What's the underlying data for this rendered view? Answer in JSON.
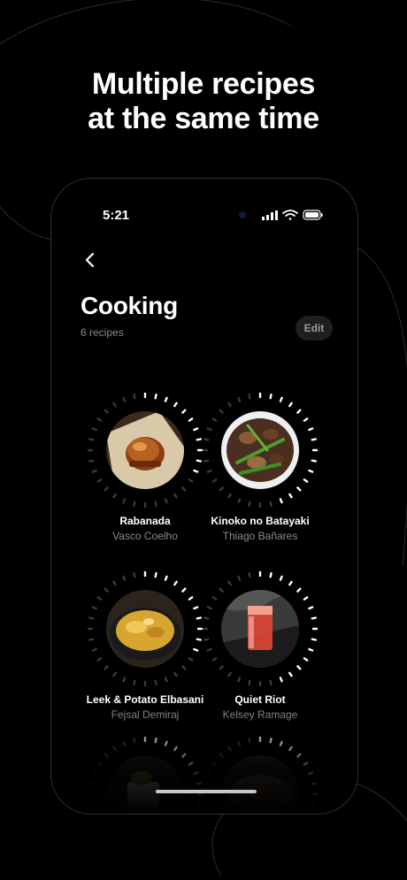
{
  "headline": {
    "line1": "Multiple recipes",
    "line2": "at the same time"
  },
  "status_bar": {
    "time": "5:21"
  },
  "nav": {
    "back_icon": "chevron-left-icon"
  },
  "page": {
    "title": "Cooking",
    "subtitle": "6 recipes",
    "edit_label": "Edit"
  },
  "recipes": [
    {
      "name": "Rabanada",
      "author": "Vasco Coelho"
    },
    {
      "name": "Kinoko no Batayaki",
      "author": "Thiago Bañares"
    },
    {
      "name": "Leek & Potato Elbasani",
      "author": "Fejsal Demiraj"
    },
    {
      "name": "Quiet Riot",
      "author": "Kelsey Ramage"
    },
    {
      "name": "",
      "author": ""
    },
    {
      "name": "",
      "author": ""
    }
  ],
  "colors": {
    "background": "#000000",
    "text": "#ffffff",
    "secondary_text": "#8a8a8a",
    "edit_bg": "#1e1e1e"
  }
}
